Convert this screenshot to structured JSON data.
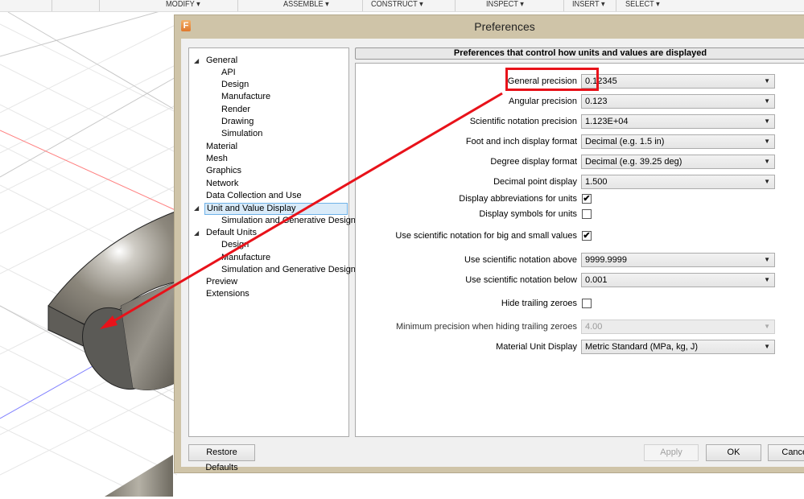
{
  "toolbar": {
    "items": [
      {
        "label": "MODIFY ▾"
      },
      {
        "label": "ASSEMBLE ▾"
      },
      {
        "label": "CONSTRUCT ▾"
      },
      {
        "label": "INSPECT ▾"
      },
      {
        "label": "INSERT ▾"
      },
      {
        "label": "SELECT ▾"
      }
    ]
  },
  "dialog": {
    "title": "Preferences",
    "app_icon": "F",
    "section_header": "Preferences that control how units and values are displayed",
    "tree": [
      {
        "label": "General",
        "level": 0,
        "expanded": true
      },
      {
        "label": "API",
        "level": 1
      },
      {
        "label": "Design",
        "level": 1
      },
      {
        "label": "Manufacture",
        "level": 1
      },
      {
        "label": "Render",
        "level": 1
      },
      {
        "label": "Drawing",
        "level": 1
      },
      {
        "label": "Simulation",
        "level": 1
      },
      {
        "label": "Material",
        "level": 0
      },
      {
        "label": "Mesh",
        "level": 0
      },
      {
        "label": "Graphics",
        "level": 0
      },
      {
        "label": "Network",
        "level": 0
      },
      {
        "label": "Data Collection and Use",
        "level": 0
      },
      {
        "label": "Unit and Value Display",
        "level": 0,
        "expanded": true,
        "selected": true
      },
      {
        "label": "Simulation and Generative Design",
        "level": 1
      },
      {
        "label": "Default Units",
        "level": 0,
        "expanded": true
      },
      {
        "label": "Design",
        "level": 1
      },
      {
        "label": "Manufacture",
        "level": 1
      },
      {
        "label": "Simulation and Generative Design",
        "level": 1
      },
      {
        "label": "Preview",
        "level": 0
      },
      {
        "label": "Extensions",
        "level": 0
      }
    ],
    "settings": {
      "general_precision": {
        "label": "General precision",
        "value": "0.12345"
      },
      "angular_precision": {
        "label": "Angular precision",
        "value": "0.123"
      },
      "scientific_precision": {
        "label": "Scientific notation precision",
        "value": "1.123E+04"
      },
      "foot_inch_format": {
        "label": "Foot and inch display format",
        "value": "Decimal (e.g. 1.5 in)"
      },
      "degree_format": {
        "label": "Degree display format",
        "value": "Decimal (e.g. 39.25 deg)"
      },
      "decimal_point": {
        "label": "Decimal point display",
        "value": "1.500"
      },
      "display_abbreviations": {
        "label": "Display abbreviations for units",
        "checked": true
      },
      "display_symbols": {
        "label": "Display symbols for units",
        "checked": false
      },
      "use_scientific": {
        "label": "Use scientific notation for big and small values",
        "checked": true
      },
      "sci_above": {
        "label": "Use scientific notation above",
        "value": "9999.9999"
      },
      "sci_below": {
        "label": "Use scientific notation below",
        "value": "0.001"
      },
      "hide_trailing_zeroes": {
        "label": "Hide trailing zeroes",
        "checked": false
      },
      "min_precision": {
        "label": "Minimum precision when hiding trailing zeroes",
        "value": "4.00",
        "disabled": true
      },
      "material_unit": {
        "label": "Material Unit Display",
        "value": "Metric Standard (MPa, kg, J)"
      }
    },
    "buttons": {
      "restore_defaults": "Restore Defaults",
      "apply": "Apply",
      "ok": "OK",
      "cancel": "Cancel"
    }
  },
  "glyphs": {
    "dropdown_arrow": "▼",
    "check": "✔",
    "expander": "◢"
  },
  "colors": {
    "annotation_red": "#e8121a",
    "dialog_frame": "#cfc4a8",
    "selection_bg": "#d9ebf9",
    "selection_border": "#6fb2e8"
  }
}
